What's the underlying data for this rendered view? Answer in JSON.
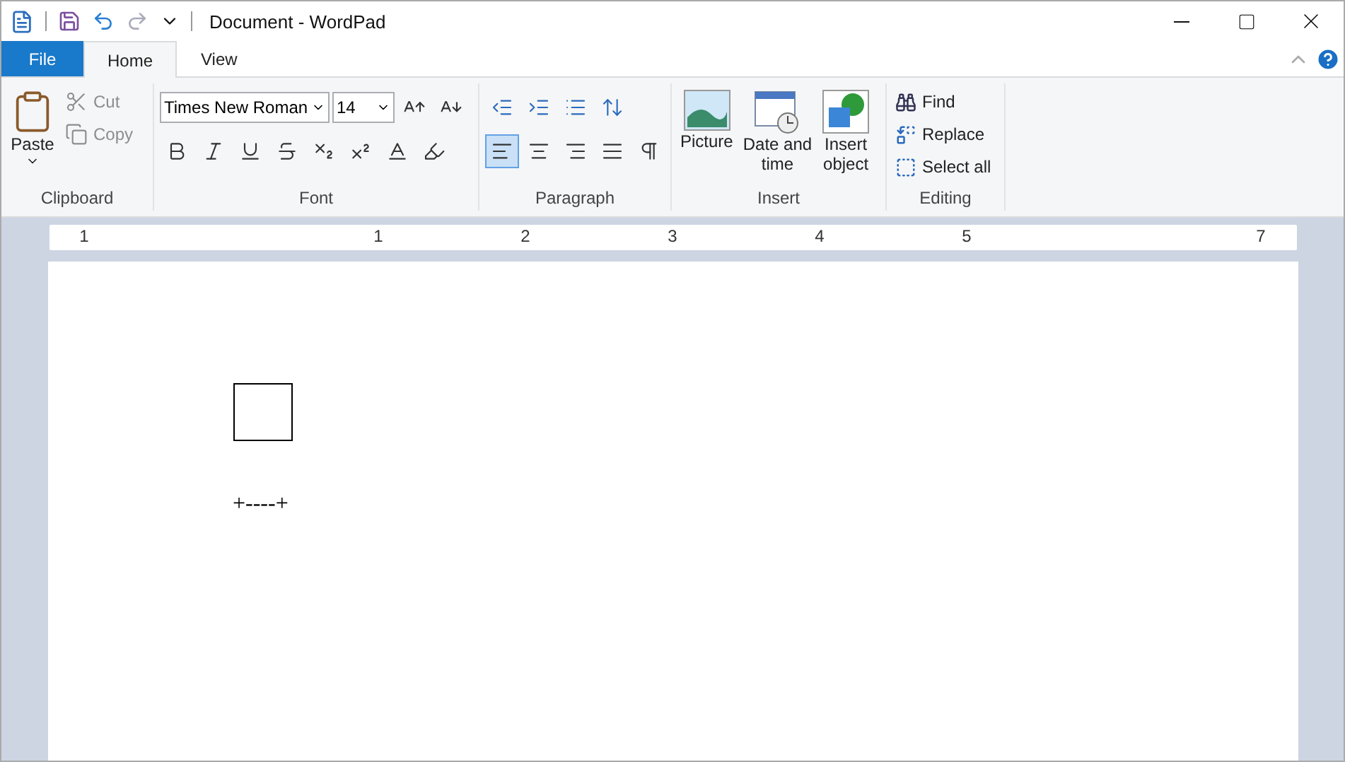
{
  "title_bar": {
    "title": "Document - WordPad"
  },
  "tabs": [
    {
      "label": "File",
      "kind": "file",
      "selected": false
    },
    {
      "label": "Home",
      "kind": "tab",
      "selected": true
    },
    {
      "label": "View",
      "kind": "tab",
      "selected": false
    }
  ],
  "clipboard": {
    "label": "Clipboard",
    "paste": "Paste",
    "cut": {
      "label": "Cut",
      "disabled": true
    },
    "copy": {
      "label": "Copy",
      "disabled": true
    }
  },
  "font": {
    "label": "Font",
    "family": "Times New Roman",
    "size": "14"
  },
  "paragraph": {
    "label": "Paragraph",
    "alignments": [
      {
        "kind": "left",
        "selected": true
      },
      {
        "kind": "center",
        "selected": false
      },
      {
        "kind": "right",
        "selected": false
      },
      {
        "kind": "justify",
        "selected": false
      }
    ]
  },
  "insert": {
    "label": "Insert",
    "buttons": [
      {
        "kind": "picture",
        "lines": [
          "Picture"
        ]
      },
      {
        "kind": "datetime",
        "lines": [
          "Date and",
          "time"
        ]
      },
      {
        "kind": "object",
        "lines": [
          "Insert",
          "object"
        ]
      }
    ]
  },
  "editing": {
    "label": "Editing",
    "buttons": [
      {
        "kind": "find",
        "label": "Find"
      },
      {
        "kind": "replace",
        "label": "Replace"
      },
      {
        "kind": "selectall",
        "label": "Select all"
      }
    ]
  },
  "ruler": {
    "labels": [
      "1",
      "1",
      "2",
      "3",
      "4",
      "5",
      "7"
    ]
  },
  "document": {
    "text": "+----+"
  }
}
